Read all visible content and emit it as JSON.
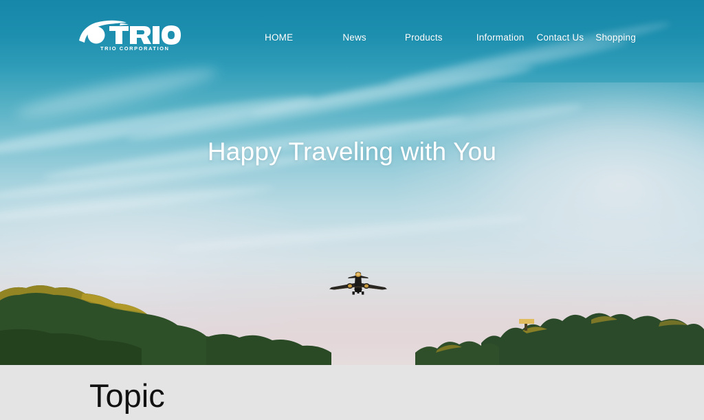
{
  "site": {
    "brand": {
      "logo_text": "TRIO",
      "tagline": "TRIO CORPORATION",
      "logo_icon": "trio-swoosh-circle-logo"
    },
    "nav": {
      "items": [
        {
          "label": "HOME"
        },
        {
          "label": "News"
        },
        {
          "label": "Products"
        },
        {
          "label": "Information"
        },
        {
          "label": "Contact Us"
        },
        {
          "label": "Shopping"
        }
      ]
    }
  },
  "hero": {
    "headline": "Happy Traveling with You",
    "imagery": {
      "airplane": "airliner-landing-silhouette",
      "treeline": "tree-line-silhouette",
      "sky": "blue-sky-with-cirrus-clouds"
    }
  },
  "topic": {
    "title": "Topic"
  },
  "colors": {
    "sky_top": "#1787a9",
    "sky_mid": "#9fd0dc",
    "sky_horizon": "#e2dee0",
    "section_bg": "#e4e4e4",
    "nav_text": "#ffffff",
    "headline_text": "#ffffff",
    "topic_text": "#111111",
    "tree_green": "#2f4f2a",
    "tree_gold": "#b9a02a"
  }
}
